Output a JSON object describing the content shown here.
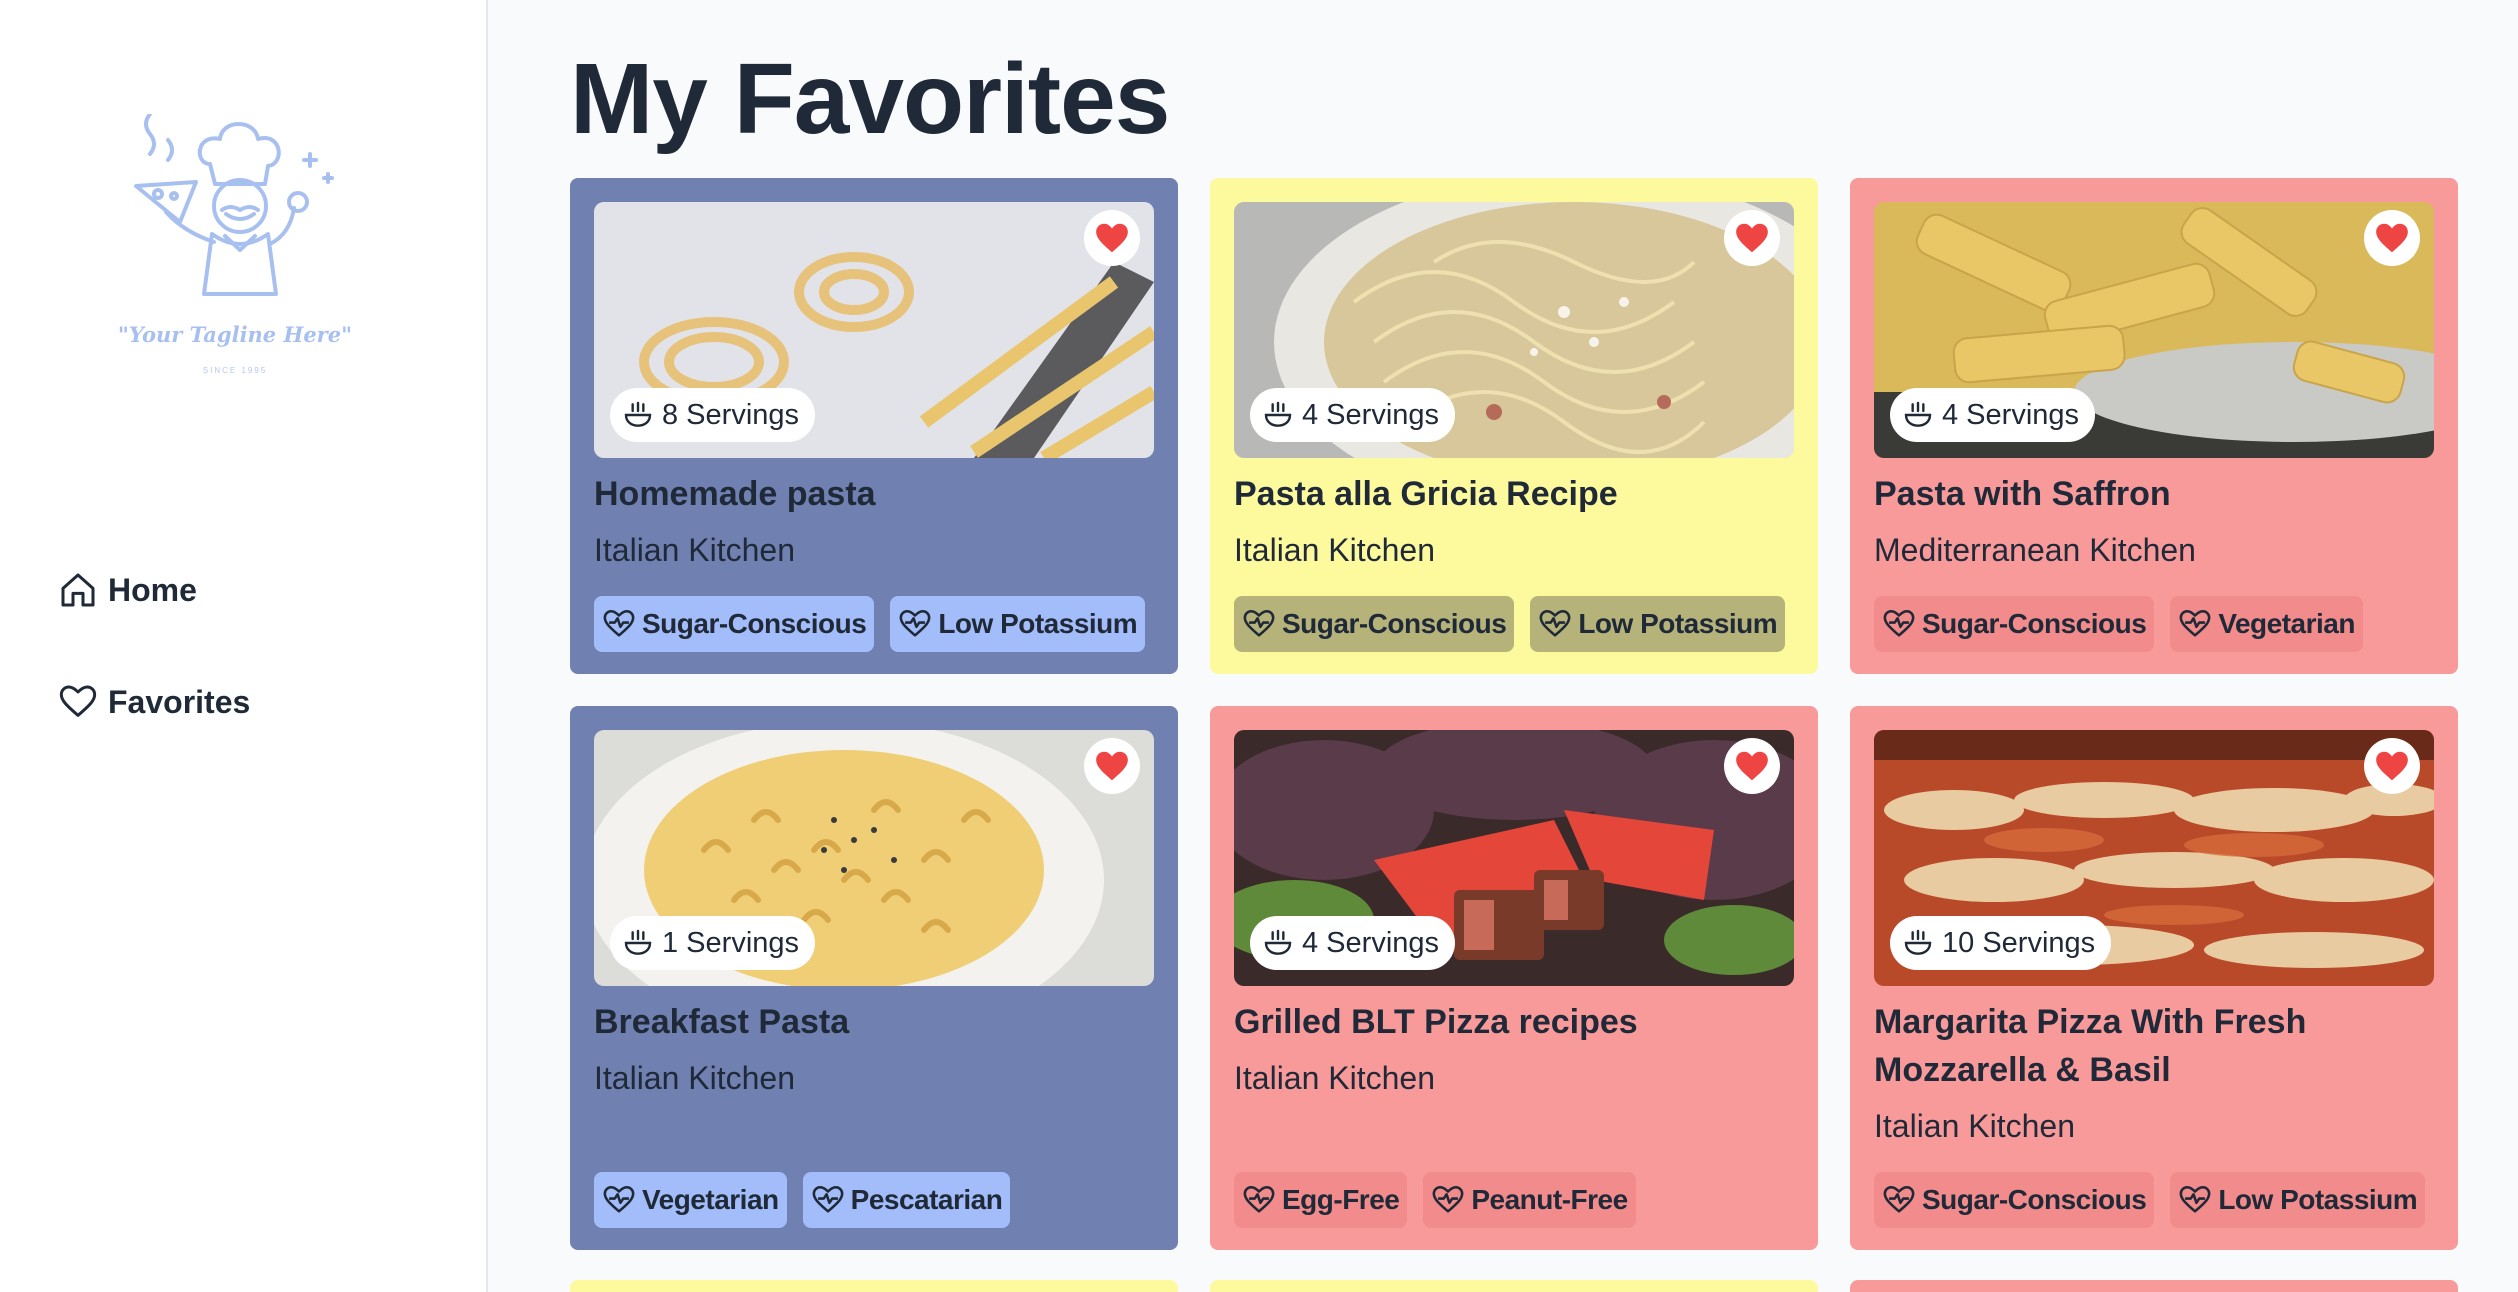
{
  "sidebar": {
    "logo": {
      "tagline": "\"Your Tagline Here\"",
      "since": "SINCE 1995"
    },
    "nav": [
      {
        "label": "Home",
        "icon": "home-icon"
      },
      {
        "label": "Favorites",
        "icon": "heart-outline-icon"
      }
    ]
  },
  "main": {
    "title": "My Favorites",
    "cards": [
      {
        "title": "Homemade pasta",
        "cuisine": "Italian Kitchen",
        "servings": "8 Servings",
        "color": "#6f80b1",
        "tags": [
          "Sugar-Conscious",
          "Low Potassium"
        ],
        "favorite": true
      },
      {
        "title": "Pasta alla Gricia Recipe",
        "cuisine": "Italian Kitchen",
        "servings": "4 Servings",
        "color": "#fdfa9d",
        "tags": [
          "Sugar-Conscious",
          "Low Potassium"
        ],
        "favorite": true
      },
      {
        "title": "Pasta with Saffron",
        "cuisine": "Mediterranean Kitchen",
        "servings": "4 Servings",
        "color": "#f99a9a",
        "tags": [
          "Sugar-Conscious",
          "Vegetarian"
        ],
        "favorite": true
      },
      {
        "title": "Breakfast Pasta",
        "cuisine": "Italian Kitchen",
        "servings": "1 Servings",
        "color": "#6f80b1",
        "tags": [
          "Vegetarian",
          "Pescatarian"
        ],
        "favorite": true
      },
      {
        "title": "Grilled BLT Pizza recipes",
        "cuisine": "Italian Kitchen",
        "servings": "4 Servings",
        "color": "#f99a9a",
        "tags": [
          "Egg-Free",
          "Peanut-Free"
        ],
        "favorite": true
      },
      {
        "title": "Margarita Pizza With Fresh Mozzarella & Basil",
        "cuisine": "Italian Kitchen",
        "servings": "10 Servings",
        "color": "#f99a9a",
        "tags": [
          "Sugar-Conscious",
          "Low Potassium"
        ],
        "favorite": true
      }
    ]
  },
  "colors": {
    "heart": "#ef4444",
    "blue_card": "#6f80b1",
    "yellow_card": "#fdfa9d",
    "red_card": "#f99a9a"
  }
}
